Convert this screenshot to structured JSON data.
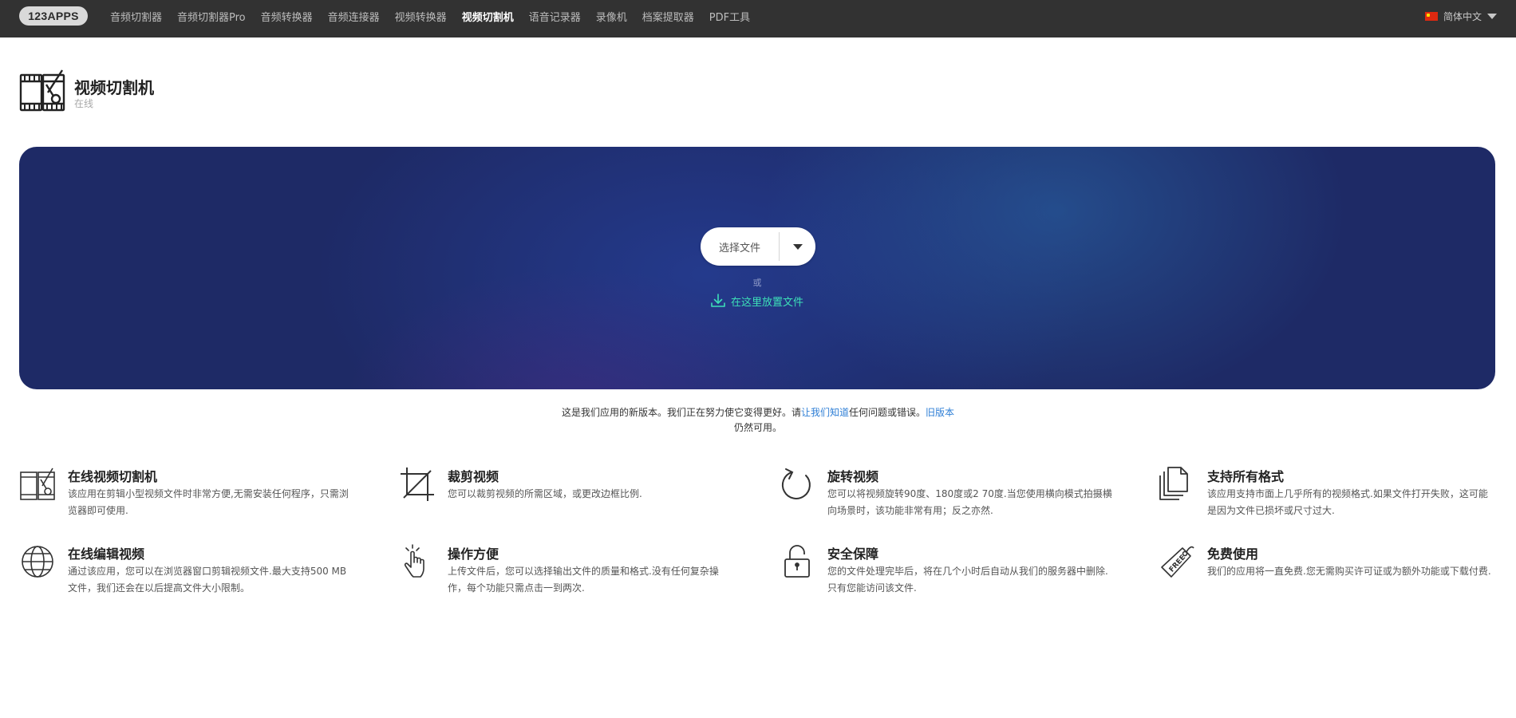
{
  "nav": {
    "logo": "123APPS",
    "items": [
      {
        "label": "音频切割器",
        "active": false
      },
      {
        "label": "音频切割器Pro",
        "active": false
      },
      {
        "label": "音频转换器",
        "active": false
      },
      {
        "label": "音频连接器",
        "active": false
      },
      {
        "label": "视频转换器",
        "active": false
      },
      {
        "label": "视频切割机",
        "active": true
      },
      {
        "label": "语音记录器",
        "active": false
      },
      {
        "label": "录像机",
        "active": false
      },
      {
        "label": "档案提取器",
        "active": false
      },
      {
        "label": "PDF工具",
        "active": false
      }
    ],
    "language": "简体中文"
  },
  "app": {
    "title": "视频切割机",
    "subtitle": "在线"
  },
  "hero": {
    "choose_file": "选择文件",
    "or": "或",
    "drop_here": "在这里放置文件"
  },
  "notice": {
    "part1": "这是我们应用的新版本。我们正在努力使它变得更好。请",
    "link1": "让我们知道",
    "part2": "任何问题或错误。",
    "link2": "旧版本",
    "part3": "仍然可用。"
  },
  "features": [
    {
      "icon": "video-cutter-icon",
      "title": "在线视频切割机",
      "desc": "该应用在剪辑小型视频文件时非常方便,无需安装任何程序，只需浏览器即可使用."
    },
    {
      "icon": "crop-icon",
      "title": "裁剪视频",
      "desc": "您可以裁剪视频的所需区域，或更改边框比例."
    },
    {
      "icon": "rotate-icon",
      "title": "旋转视频",
      "desc": "您可以将视频旋转90度、180度或2 70度.当您使用横向模式拍摄横向场景时，该功能非常有用；反之亦然."
    },
    {
      "icon": "files-icon",
      "title": "支持所有格式",
      "desc": "该应用支持市面上几乎所有的视频格式.如果文件打开失败，这可能是因为文件已损坏或尺寸过大."
    },
    {
      "icon": "globe-icon",
      "title": "在线编辑视频",
      "desc": "通过该应用，您可以在浏览器窗口剪辑视频文件.最大支持500 MB文件，我们还会在以后提高文件大小限制。"
    },
    {
      "icon": "pointer-hand-icon",
      "title": "操作方便",
      "desc": "上传文件后，您可以选择输出文件的质量和格式.没有任何复杂操作，每个功能只需点击一到两次."
    },
    {
      "icon": "lock-icon",
      "title": "安全保障",
      "desc": "您的文件处理完毕后，将在几个小时后自动从我们的服务器中删除.只有您能访问该文件."
    },
    {
      "icon": "free-tag-icon",
      "title": "免费使用",
      "desc": "我们的应用将一直免费.您无需购买许可证或为额外功能或下载付费."
    }
  ]
}
